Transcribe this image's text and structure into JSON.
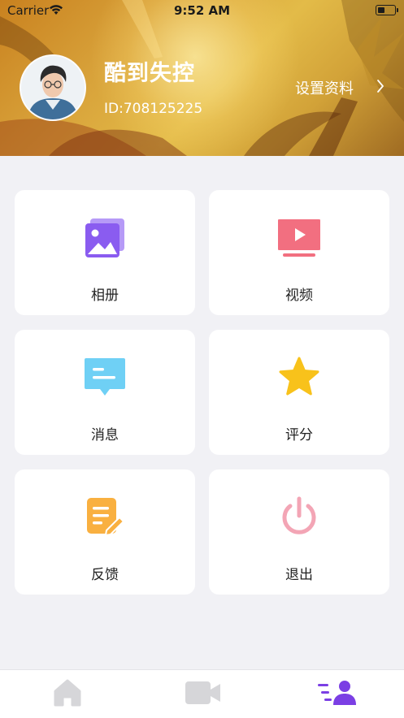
{
  "status_bar": {
    "carrier": "Carrier",
    "time": "9:52 AM"
  },
  "profile": {
    "username": "酷到失控",
    "user_id": "ID:708125225",
    "settings_label": "设置资料"
  },
  "menu": {
    "items": [
      {
        "label": "相册",
        "icon": "photo-album-icon",
        "color": "#8a5cf0"
      },
      {
        "label": "视频",
        "icon": "video-icon",
        "color": "#f26f80"
      },
      {
        "label": "消息",
        "icon": "message-icon",
        "color": "#6fd0f5"
      },
      {
        "label": "评分",
        "icon": "star-icon",
        "color": "#f8c21b"
      },
      {
        "label": "反馈",
        "icon": "feedback-icon",
        "color": "#f9b040"
      },
      {
        "label": "退出",
        "icon": "power-icon",
        "color": "#f3a5b5"
      }
    ]
  },
  "tab_bar": {
    "tabs": [
      {
        "icon": "home-icon",
        "active": false
      },
      {
        "icon": "video-camera-icon",
        "active": false
      },
      {
        "icon": "profile-list-icon",
        "active": true
      }
    ],
    "active_color": "#7b3fe4",
    "inactive_color": "#d6d6d9"
  }
}
